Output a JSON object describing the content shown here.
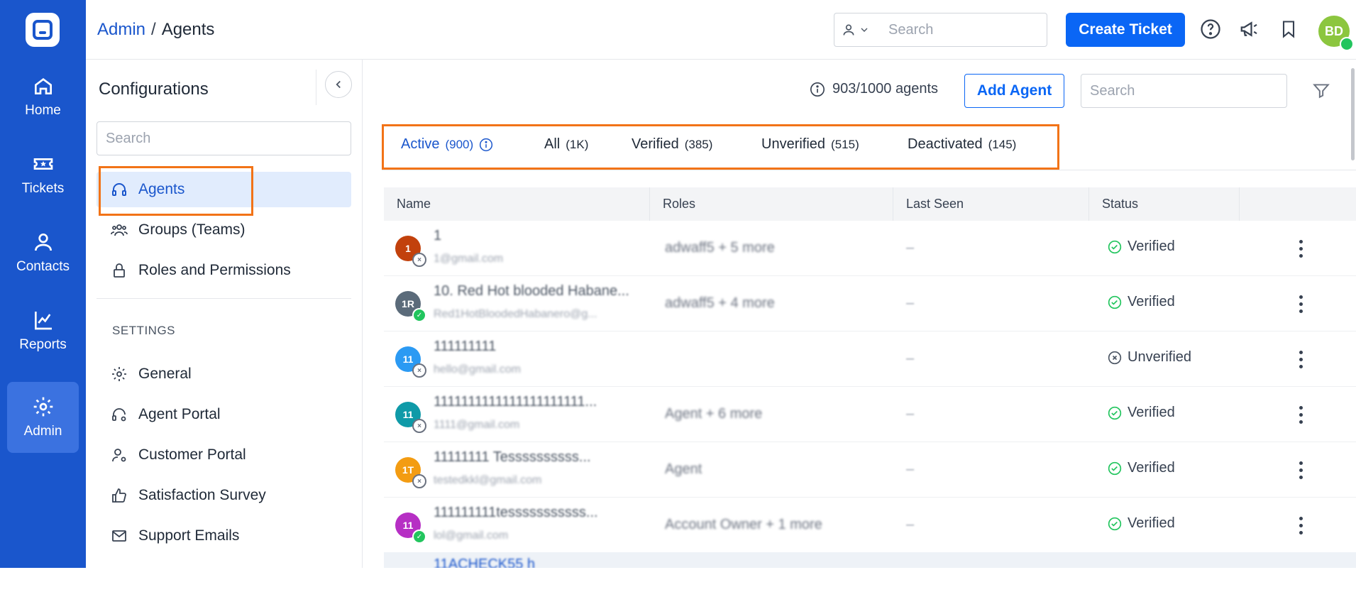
{
  "rail": {
    "items": [
      {
        "label": "Home",
        "icon": "home-icon"
      },
      {
        "label": "Tickets",
        "icon": "ticket-icon"
      },
      {
        "label": "Contacts",
        "icon": "user-icon"
      },
      {
        "label": "Reports",
        "icon": "chart-icon"
      },
      {
        "label": "Admin",
        "icon": "gear-icon",
        "active": true
      }
    ]
  },
  "header": {
    "breadcrumb_parent": "Admin",
    "breadcrumb_sep": "/",
    "breadcrumb_current": "Agents",
    "search_placeholder": "Search",
    "create_ticket_label": "Create Ticket",
    "avatar_initials": "BD"
  },
  "config": {
    "title": "Configurations",
    "search_placeholder": "Search",
    "items": [
      {
        "label": "Agents",
        "icon": "headset-icon",
        "active": true
      },
      {
        "label": "Groups (Teams)",
        "icon": "group-icon"
      },
      {
        "label": "Roles and Permissions",
        "icon": "lock-icon"
      }
    ],
    "settings_label": "SETTINGS",
    "settings_items": [
      {
        "label": "General",
        "icon": "gear-icon"
      },
      {
        "label": "Agent Portal",
        "icon": "headset-gear-icon"
      },
      {
        "label": "Customer Portal",
        "icon": "user-gear-icon"
      },
      {
        "label": "Satisfaction Survey",
        "icon": "thumbs-up-icon"
      },
      {
        "label": "Support Emails",
        "icon": "mail-icon"
      }
    ]
  },
  "main": {
    "agent_count": "903/1000 agents",
    "add_agent_label": "Add Agent",
    "search_placeholder": "Search",
    "tabs": [
      {
        "label": "Active",
        "count": "(900)"
      },
      {
        "label": "All",
        "count": "(1K)"
      },
      {
        "label": "Verified",
        "count": "(385)"
      },
      {
        "label": "Unverified",
        "count": "(515)"
      },
      {
        "label": "Deactivated",
        "count": "(145)"
      }
    ],
    "columns": [
      "Name",
      "Roles",
      "Last Seen",
      "Status"
    ],
    "rows": [
      {
        "initials": "1",
        "color": "#c2410c",
        "online": false,
        "name": "1",
        "email": "1@gmail.com",
        "roles": "adwaff5 + 5 more",
        "last_seen": "–",
        "status": "Verified"
      },
      {
        "initials": "1R",
        "color": "#5b6b7a",
        "online": true,
        "name": "10. Red Hot blooded Habane...",
        "email": "Red1HotBloodedHabanero@g...",
        "roles": "adwaff5 + 4 more",
        "last_seen": "–",
        "status": "Verified"
      },
      {
        "initials": "11",
        "color": "#2b9af3",
        "online": false,
        "name": "111111111",
        "email": "hello@gmail.com",
        "roles": "",
        "last_seen": "–",
        "status": "Unverified"
      },
      {
        "initials": "11",
        "color": "#0f9aa8",
        "online": false,
        "name": "1111111111111111111111...",
        "email": "1111@gmail.com",
        "roles": "Agent + 6 more",
        "last_seen": "–",
        "status": "Verified"
      },
      {
        "initials": "1T",
        "color": "#f39c12",
        "online": false,
        "name": "11111111 Tessssssssss...",
        "email": "testedkkl@gmail.com",
        "roles": "Agent",
        "last_seen": "–",
        "status": "Verified"
      },
      {
        "initials": "11",
        "color": "#b62fc4",
        "online": true,
        "name": "111111111tesssssssssss...",
        "email": "lol@gmail.com",
        "roles": "Account Owner + 1 more",
        "last_seen": "–",
        "status": "Verified"
      }
    ],
    "partial_row_name": "11ACHECK55 h"
  }
}
